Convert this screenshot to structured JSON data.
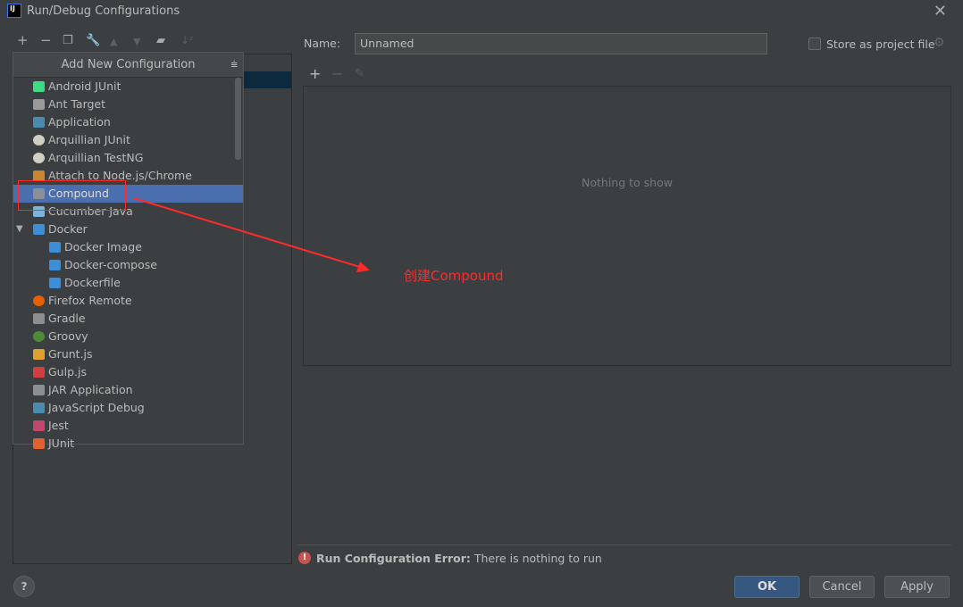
{
  "window": {
    "title": "Run/Debug Configurations",
    "logo": "IJ"
  },
  "toolbar": {
    "icons": [
      "plus-icon",
      "minus-icon",
      "copy-icon",
      "wrench-icon",
      "arrow-up-icon",
      "arrow-down-icon",
      "new-folder-icon",
      "sort-icon"
    ]
  },
  "popup": {
    "title": "Add New Configuration",
    "items": [
      {
        "label": "Android JUnit",
        "icon": "android-icon",
        "color": "#3ddc84"
      },
      {
        "label": "Ant Target",
        "icon": "ant-icon",
        "color": "#9a9a9a"
      },
      {
        "label": "Application",
        "icon": "application-icon",
        "color": "#4a8cb0"
      },
      {
        "label": "Arquillian JUnit",
        "icon": "arquillian-icon",
        "color": "#d0d0c0"
      },
      {
        "label": "Arquillian TestNG",
        "icon": "arquillian-icon",
        "color": "#d0d0c0"
      },
      {
        "label": "Attach to Node.js/Chrome",
        "icon": "nodejs-attach-icon",
        "color": "#c9862f"
      },
      {
        "label": "Compound",
        "icon": "compound-icon",
        "color": "#8a8f94",
        "selected": true
      },
      {
        "label": "Cucumber Java",
        "icon": "cucumber-icon",
        "color": "#7db4d9"
      },
      {
        "label": "Docker",
        "icon": "docker-icon",
        "color": "#3c8ed6",
        "expanded": true
      },
      {
        "label": "Docker Image",
        "icon": "docker-icon",
        "color": "#3c8ed6",
        "child": true
      },
      {
        "label": "Docker-compose",
        "icon": "docker-icon",
        "color": "#3c8ed6",
        "child": true
      },
      {
        "label": "Dockerfile",
        "icon": "docker-icon",
        "color": "#3c8ed6",
        "child": true
      },
      {
        "label": "Firefox Remote",
        "icon": "firefox-icon",
        "color": "#e66000"
      },
      {
        "label": "Gradle",
        "icon": "gradle-icon",
        "color": "#8a8f94"
      },
      {
        "label": "Groovy",
        "icon": "groovy-icon",
        "color": "#4f8a3a"
      },
      {
        "label": "Grunt.js",
        "icon": "grunt-icon",
        "color": "#e0a030"
      },
      {
        "label": "Gulp.js",
        "icon": "gulp-icon",
        "color": "#d04040"
      },
      {
        "label": "JAR Application",
        "icon": "jar-icon",
        "color": "#8a8f94"
      },
      {
        "label": "JavaScript Debug",
        "icon": "js-debug-icon",
        "color": "#4a8cb0"
      },
      {
        "label": "Jest",
        "icon": "jest-icon",
        "color": "#c2486b"
      },
      {
        "label": "JUnit",
        "icon": "junit-icon",
        "color": "#e06030"
      }
    ]
  },
  "form": {
    "name_label": "Name:",
    "name_value": "Unnamed",
    "store_label": "Store as project file",
    "store_checked": false,
    "empty_text": "Nothing to show"
  },
  "error": {
    "title": "Run Configuration Error:",
    "message": "There is nothing to run"
  },
  "buttons": {
    "ok": "OK",
    "cancel": "Cancel",
    "apply": "Apply",
    "help": "?"
  },
  "annotation": {
    "text": "创建Compound",
    "color": "#ff2a2a"
  }
}
